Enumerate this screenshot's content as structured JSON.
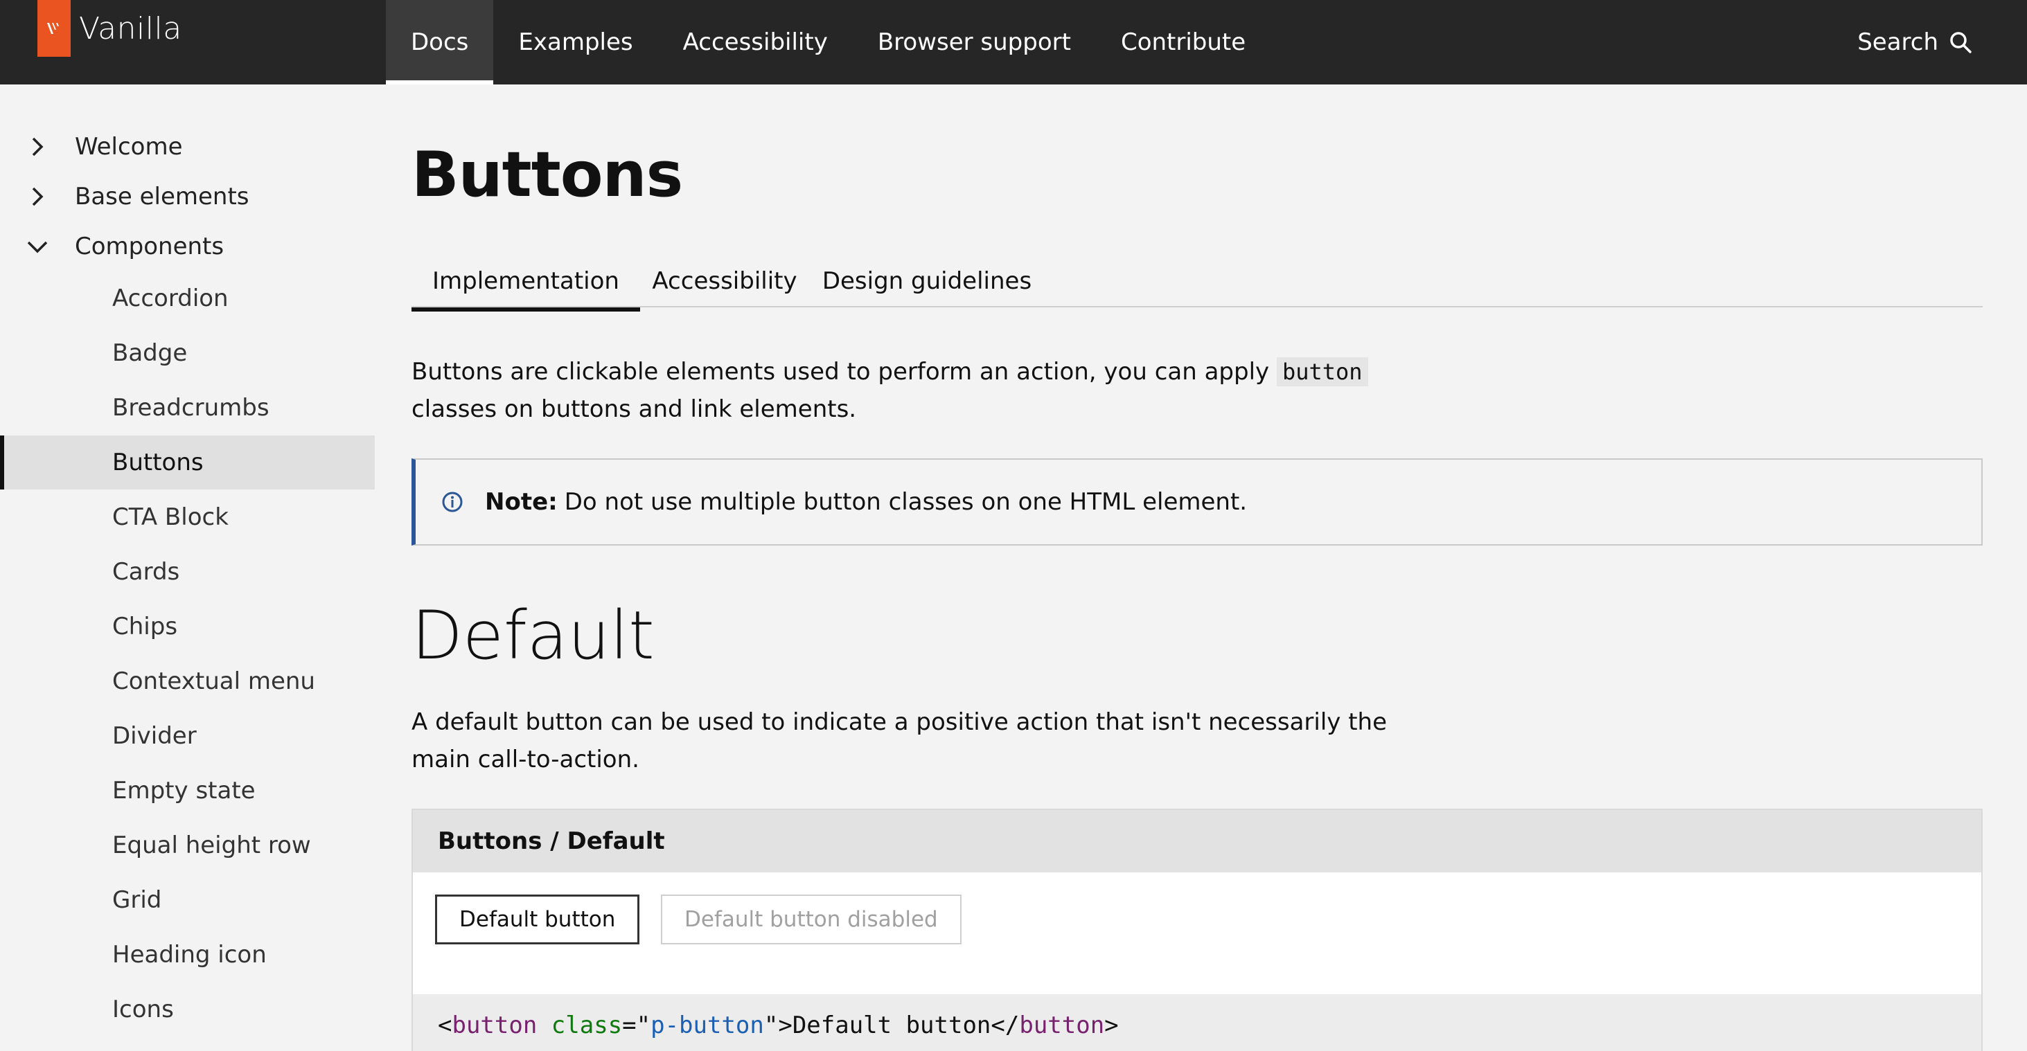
{
  "brand": {
    "name": "Vanilla",
    "accent": "#e95420"
  },
  "topnav": {
    "items": [
      {
        "label": "Docs",
        "active": true
      },
      {
        "label": "Examples"
      },
      {
        "label": "Accessibility"
      },
      {
        "label": "Browser support"
      },
      {
        "label": "Contribute"
      }
    ],
    "search_label": "Search"
  },
  "sidebar": {
    "top_items": [
      {
        "label": "Welcome",
        "expanded": false
      },
      {
        "label": "Base elements",
        "expanded": false
      },
      {
        "label": "Components",
        "expanded": true
      }
    ],
    "sub_items": [
      "Accordion",
      "Badge",
      "Breadcrumbs",
      "Buttons",
      "CTA Block",
      "Cards",
      "Chips",
      "Contextual menu",
      "Divider",
      "Empty state",
      "Equal height row",
      "Grid",
      "Heading icon",
      "Icons"
    ],
    "active_sub": "Buttons"
  },
  "main": {
    "title": "Buttons",
    "tabs": [
      {
        "label": "Implementation",
        "active": true
      },
      {
        "label": "Accessibility"
      },
      {
        "label": "Design guidelines"
      }
    ],
    "intro_before": "Buttons are clickable elements used to perform an action, you can apply ",
    "intro_code": "button",
    "intro_after": " classes on buttons and link elements.",
    "note_label": "Note:",
    "note_text": "Do not use multiple button classes on one HTML element.",
    "section_title": "Default",
    "section_text": "A default button can be used to indicate a positive action that isn't necessarily the main call-to-action.",
    "example": {
      "title": "Buttons / Default",
      "button_label": "Default button",
      "disabled_label": "Default button disabled",
      "code": {
        "lt": "<",
        "tag": "button",
        "sp": " ",
        "attr": "class",
        "eq": "=\"",
        "val": "p-button",
        "close": "\">Default button</",
        "tag2": "button",
        "gt": ">"
      }
    }
  }
}
